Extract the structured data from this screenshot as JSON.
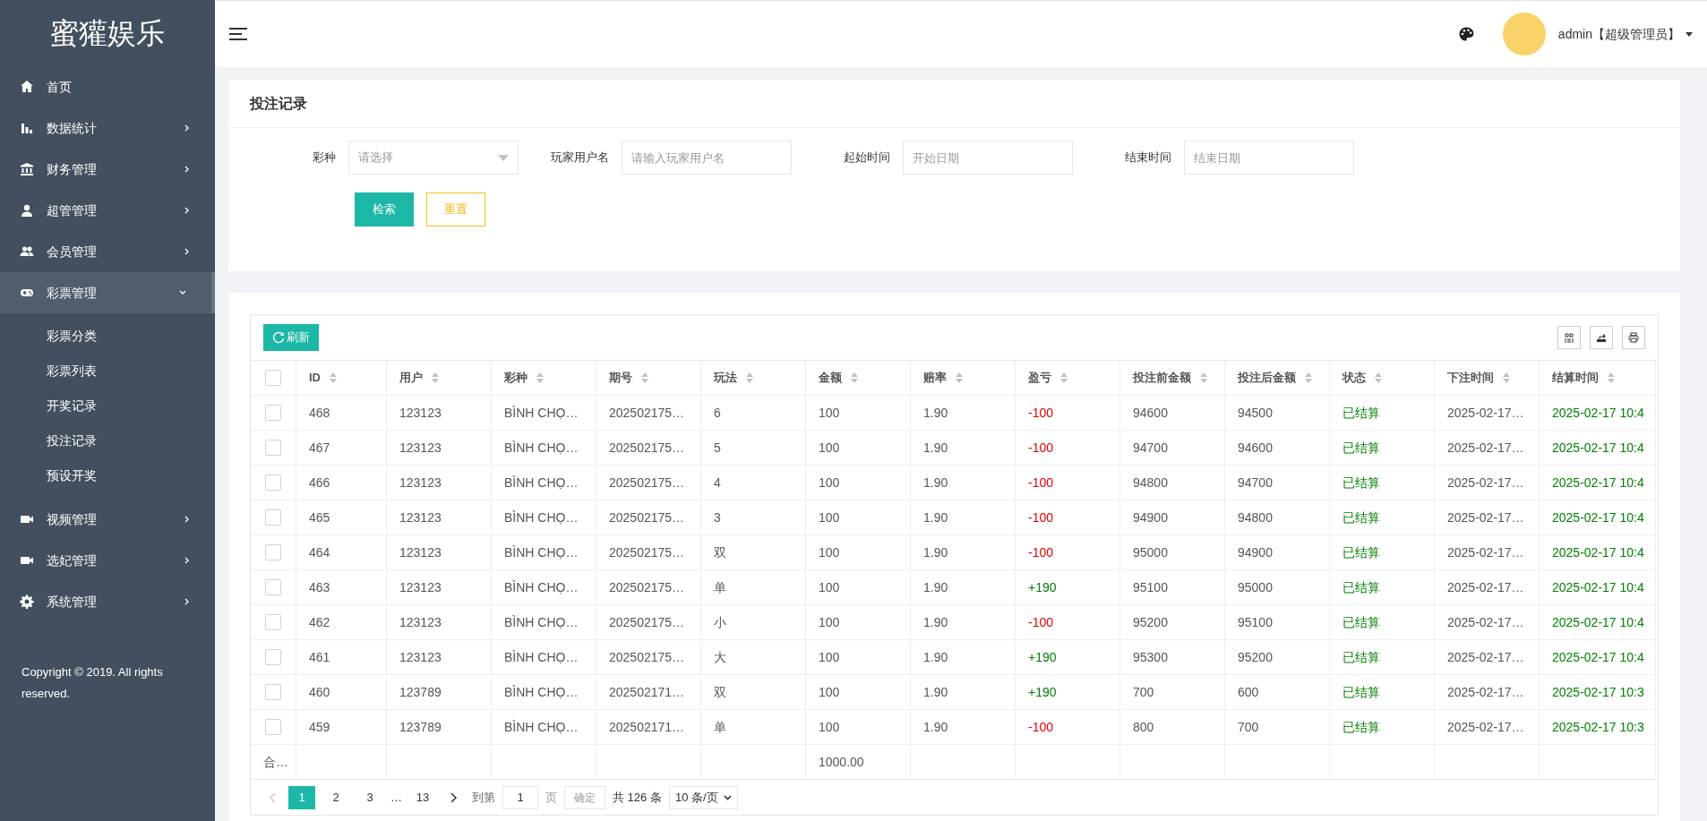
{
  "brand": "蜜獾娱乐",
  "sidebar": {
    "items": [
      {
        "label": "首页"
      },
      {
        "label": "数据统计",
        "expanded": false
      },
      {
        "label": "财务管理",
        "expanded": false
      },
      {
        "label": "超管管理",
        "expanded": false
      },
      {
        "label": "会员管理",
        "expanded": false
      },
      {
        "label": "彩票管理",
        "expanded": true,
        "children": [
          {
            "label": "彩票分类"
          },
          {
            "label": "彩票列表"
          },
          {
            "label": "开奖记录"
          },
          {
            "label": "投注记录"
          },
          {
            "label": "预设开奖"
          }
        ]
      },
      {
        "label": "视频管理",
        "expanded": false
      },
      {
        "label": "选妃管理",
        "expanded": false
      },
      {
        "label": "系统管理",
        "expanded": false
      }
    ],
    "copyright": "Copyright © 2019. All rights reserved."
  },
  "header": {
    "user": "admin【超级管理员】"
  },
  "page_title": "投注记录",
  "filters": [
    {
      "label": "彩种",
      "kind": "select",
      "placeholder": "请选择"
    },
    {
      "label": "玩家用户名",
      "kind": "input",
      "placeholder": "请输入玩家用户名"
    },
    {
      "label": "起始时间",
      "kind": "input",
      "placeholder": "开始日期"
    },
    {
      "label": "结束时间",
      "kind": "input",
      "placeholder": "结束日期"
    }
  ],
  "buttons": {
    "search": "检索",
    "reset": "重置",
    "refresh": "刷新"
  },
  "table": {
    "select_all_checked": false,
    "columns": [
      "ID",
      "用户",
      "彩种",
      "期号",
      "玩法",
      "金额",
      "赔率",
      "盈亏",
      "投注前金额",
      "投注后金额",
      "状态",
      "下注时间",
      "结算时间"
    ],
    "rows": [
      {
        "checked": false,
        "cells": [
          "468",
          "123123",
          "BÌNH CHỌ…",
          "202502175…",
          "6",
          "100",
          "1.90",
          "-100",
          "94600",
          "94500",
          "已结算",
          "2025-02-17…",
          "2025-02-17 10:4"
        ],
        "color": "#e00000"
      },
      {
        "checked": false,
        "cells": [
          "467",
          "123123",
          "BÌNH CHỌ…",
          "202502175…",
          "5",
          "100",
          "1.90",
          "-100",
          "94700",
          "94600",
          "已结算",
          "2025-02-17…",
          "2025-02-17 10:4"
        ],
        "color": "#e00000"
      },
      {
        "checked": false,
        "cells": [
          "466",
          "123123",
          "BÌNH CHỌ…",
          "202502175…",
          "4",
          "100",
          "1.90",
          "-100",
          "94800",
          "94700",
          "已结算",
          "2025-02-17…",
          "2025-02-17 10:4"
        ],
        "color": "#e00000"
      },
      {
        "checked": false,
        "cells": [
          "465",
          "123123",
          "BÌNH CHỌ…",
          "202502175…",
          "3",
          "100",
          "1.90",
          "-100",
          "94900",
          "94800",
          "已结算",
          "2025-02-17…",
          "2025-02-17 10:4"
        ],
        "color": "#e00000"
      },
      {
        "checked": false,
        "cells": [
          "464",
          "123123",
          "BÌNH CHỌ…",
          "202502175…",
          "双",
          "100",
          "1.90",
          "-100",
          "95000",
          "94900",
          "已结算",
          "2025-02-17…",
          "2025-02-17 10:4"
        ],
        "color": "#e00000"
      },
      {
        "checked": false,
        "cells": [
          "463",
          "123123",
          "BÌNH CHỌ…",
          "202502175…",
          "单",
          "100",
          "1.90",
          "+190",
          "95100",
          "95000",
          "已结算",
          "2025-02-17…",
          "2025-02-17 10:4"
        ],
        "color": "#008000"
      },
      {
        "checked": false,
        "cells": [
          "462",
          "123123",
          "BÌNH CHỌ…",
          "202502175…",
          "小",
          "100",
          "1.90",
          "-100",
          "95200",
          "95100",
          "已结算",
          "2025-02-17…",
          "2025-02-17 10:4"
        ],
        "color": "#e00000"
      },
      {
        "checked": false,
        "cells": [
          "461",
          "123123",
          "BÌNH CHỌ…",
          "202502175…",
          "大",
          "100",
          "1.90",
          "+190",
          "95300",
          "95200",
          "已结算",
          "2025-02-17…",
          "2025-02-17 10:4"
        ],
        "color": "#008000"
      },
      {
        "checked": false,
        "cells": [
          "460",
          "123789",
          "BÌNH CHỌ…",
          "202502171…",
          "双",
          "100",
          "1.90",
          "+190",
          "700",
          "600",
          "已结算",
          "2025-02-17…",
          "2025-02-17 10:3"
        ],
        "color": "#008000"
      },
      {
        "checked": false,
        "cells": [
          "459",
          "123789",
          "BÌNH CHỌ…",
          "202502171…",
          "单",
          "100",
          "1.90",
          "-100",
          "800",
          "700",
          "已结算",
          "2025-02-17…",
          "2025-02-17 10:3"
        ],
        "color": "#e00000"
      }
    ],
    "total_label": "合…",
    "total_amount": "1000.00"
  },
  "pagination": {
    "pages": [
      {
        "label": "1",
        "selected": true
      },
      {
        "label": "2",
        "selected": false
      },
      {
        "label": "3",
        "selected": false
      },
      {
        "label": "…",
        "kind": "gap"
      },
      {
        "label": "13",
        "selected": false
      }
    ],
    "goto_label": "到第",
    "goto_value": "1",
    "page_unit": "页",
    "confirm": "确定",
    "total": "共 126 条",
    "page_size": "10 条/页"
  }
}
